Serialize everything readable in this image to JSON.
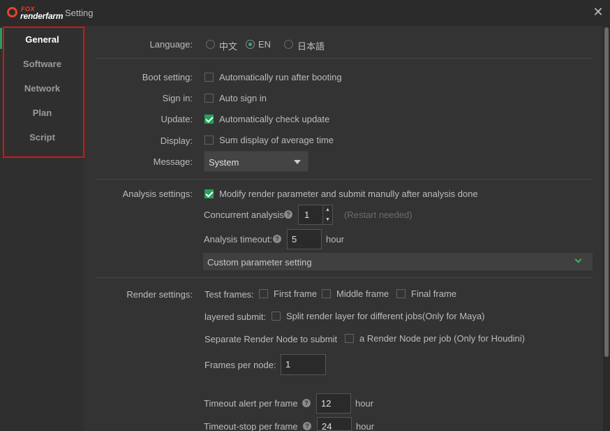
{
  "window": {
    "logo_top": "FOX",
    "logo_bottom": "renderfarm",
    "title": "Setting",
    "close_symbol": "✕"
  },
  "sidebar": {
    "items": [
      {
        "label": "General",
        "active": true
      },
      {
        "label": "Software",
        "active": false
      },
      {
        "label": "Network",
        "active": false
      },
      {
        "label": "Plan",
        "active": false
      },
      {
        "label": "Script",
        "active": false
      }
    ]
  },
  "general": {
    "language": {
      "label": "Language:",
      "options": [
        "中文",
        "EN",
        "日本語"
      ],
      "selected": "EN"
    },
    "boot": {
      "label": "Boot setting:",
      "text": "Automatically run after booting",
      "checked": false
    },
    "signin": {
      "label": "Sign in:",
      "text": "Auto sign in",
      "checked": false
    },
    "update": {
      "label": "Update:",
      "text": "Automatically check update",
      "checked": true
    },
    "display": {
      "label": "Display:",
      "text": "Sum display of average time",
      "checked": false
    },
    "message": {
      "label": "Message:",
      "value": "System"
    }
  },
  "analysis": {
    "label": "Analysis settings:",
    "modify_text": "Modify render parameter and submit manully after analysis done",
    "modify_checked": true,
    "concurrent_label": "Concurrent analysis",
    "concurrent_value": "1",
    "restart_note": "(Restart needed)",
    "timeout_label": "Analysis timeout:",
    "timeout_value": "5",
    "timeout_unit": "hour",
    "custom_param": "Custom parameter setting"
  },
  "render": {
    "label": "Render settings:",
    "test_frames_label": "Test frames:",
    "first_frame": "First frame",
    "middle_frame": "Middle frame",
    "final_frame": "Final frame",
    "layered_label": "layered submit:",
    "layered_text": "Split render layer for different jobs(Only for Maya)",
    "separate_label": "Separate Render Node to submit",
    "separate_text": "a Render Node per job (Only for Houdini)",
    "frames_per_node_label": "Frames per node:",
    "frames_per_node_value": "1",
    "timeout_alert_label": "Timeout alert per frame",
    "timeout_alert_value": "12",
    "timeout_alert_unit": "hour",
    "timeout_stop_label": "Timeout-stop per frame",
    "timeout_stop_value": "24",
    "timeout_stop_unit": "hour"
  },
  "colors": {
    "accent_green": "#21a35a",
    "highlight_red": "#e01010",
    "brand_orange": "#e8412c"
  },
  "icons": {
    "help": "?",
    "spin_up": "▲",
    "spin_down": "▼"
  }
}
